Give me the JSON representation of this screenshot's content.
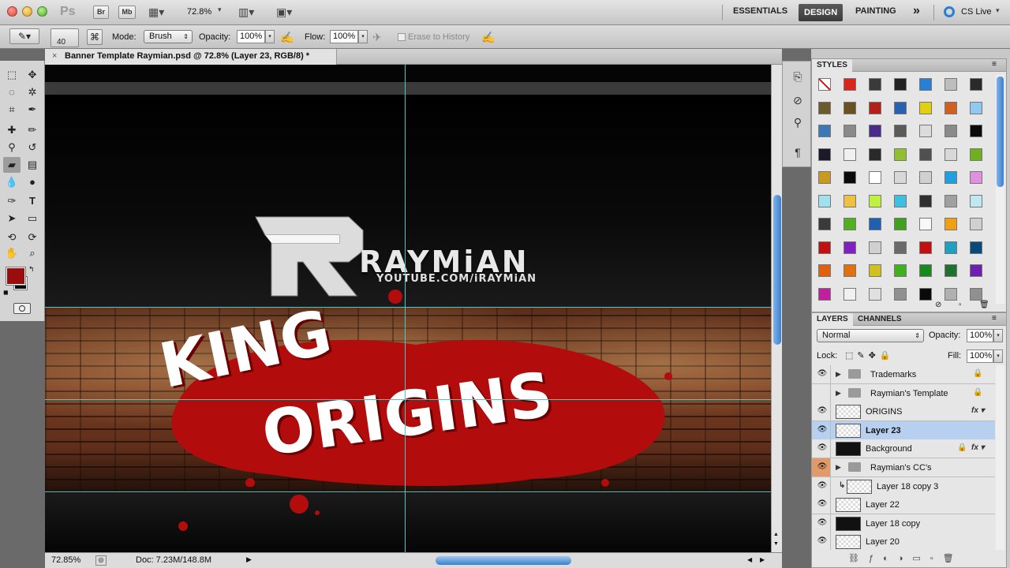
{
  "app_bar": {
    "logo": "Ps",
    "bridge_label": "Br",
    "minibridge_label": "Mb",
    "zoom": "72.8%",
    "workspaces": [
      "ESSENTIALS",
      "DESIGN",
      "PAINTING"
    ],
    "more": "»",
    "cs_live": "CS Live"
  },
  "options_bar": {
    "brush_size": "40",
    "mode_label": "Mode:",
    "mode_value": "Brush",
    "opacity_label": "Opacity:",
    "opacity_value": "100%",
    "flow_label": "Flow:",
    "flow_value": "100%",
    "erase_history_label": "Erase to History"
  },
  "document": {
    "tab_title": "Banner Template Raymian.psd @ 72.8% (Layer 23, RGB/8) *",
    "close": "×"
  },
  "canvas": {
    "logo_name": "RAYMiAN",
    "logo_url": "YOUTUBE.COM/iRAYMiAN",
    "headline_1": "KING",
    "headline_2": "ORIGINS"
  },
  "status_bar": {
    "zoom": "72.85%",
    "doc_info": "Doc: 7.23M/148.8M"
  },
  "styles_panel": {
    "tab": "STYLES",
    "swatches": [
      [
        "#ffffff",
        "#d8261a",
        "#3a3a3a",
        "#222222",
        "#2a7fd0",
        "#bdbdbd",
        "#2a2a2a"
      ],
      [
        "#6b5a2a",
        "#6b5020",
        "#b2201a",
        "#2a60b0",
        "#e0d010",
        "#d06020",
        "#90c8f0"
      ],
      [
        "#3a78b8",
        "#8a8a8a",
        "#4a2a8a",
        "#5a5a5a",
        "#dcdcdc",
        "#8a8a8a",
        "#0a0a0a"
      ],
      [
        "#1a1a2a",
        "#f0f0f0",
        "#2a2a2a",
        "#90c030",
        "#505050",
        "#d8d8d8",
        "#70b020"
      ],
      [
        "#c89a20",
        "#0a0a0a",
        "#ffffff",
        "#d8d8d8",
        "#d0d0d0",
        "#20a0e0",
        "#e090e0"
      ],
      [
        "#a0e0f0",
        "#f0c040",
        "#c0f040",
        "#40c0e0",
        "#303030",
        "#a0a0a0",
        "#c0e8f0"
      ],
      [
        "#3a3a3a",
        "#50b020",
        "#2060b0",
        "#40a020",
        "#f8f8f8",
        "#f0a010",
        "#d0d0d0"
      ],
      [
        "#c01010",
        "#8020c0",
        "#d0d0d0",
        "#6a6a6a",
        "#c01010",
        "#20a0c0",
        "#0a4a7a"
      ],
      [
        "#e06010",
        "#e07010",
        "#d0c020",
        "#40b020",
        "#1a8a20",
        "#207030",
        "#7020b0"
      ],
      [
        "#c020a0",
        "#f0f0f0",
        "#e0e0e0",
        "#909090",
        "#0a0a0a",
        "#b0b0b0",
        "#909090"
      ]
    ]
  },
  "layers_panel": {
    "tab_layers": "LAYERS",
    "tab_channels": "CHANNELS",
    "blend_mode": "Normal",
    "opacity_label": "Opacity:",
    "opacity_value": "100%",
    "lock_label": "Lock:",
    "fill_label": "Fill:",
    "fill_value": "100%",
    "layers": [
      {
        "name": "Trademarks",
        "type": "group",
        "visible": true,
        "locked": true
      },
      {
        "name": "Raymian's Template",
        "type": "group",
        "visible": false,
        "locked": true
      },
      {
        "name": "ORIGINS",
        "type": "layer",
        "visible": true,
        "fx": true
      },
      {
        "name": "Layer 23",
        "type": "layer",
        "visible": true,
        "selected": true
      },
      {
        "name": "Background",
        "type": "layer",
        "visible": true,
        "locked": true,
        "fx": true
      },
      {
        "name": "Raymian's CC's",
        "type": "group",
        "visible": true
      },
      {
        "name": "Layer 18 copy 3",
        "type": "layer",
        "visible": true,
        "clipped": true
      },
      {
        "name": "Layer 22",
        "type": "layer",
        "visible": true
      },
      {
        "name": "Layer 18 copy",
        "type": "layer",
        "visible": true
      },
      {
        "name": "Layer 20",
        "type": "layer",
        "visible": true
      }
    ]
  },
  "colors": {
    "foreground": "#9a0d0d",
    "background": "#0a0a0a",
    "accent_blue": "#3d7fcc",
    "blood_red": "#b20c0c"
  }
}
